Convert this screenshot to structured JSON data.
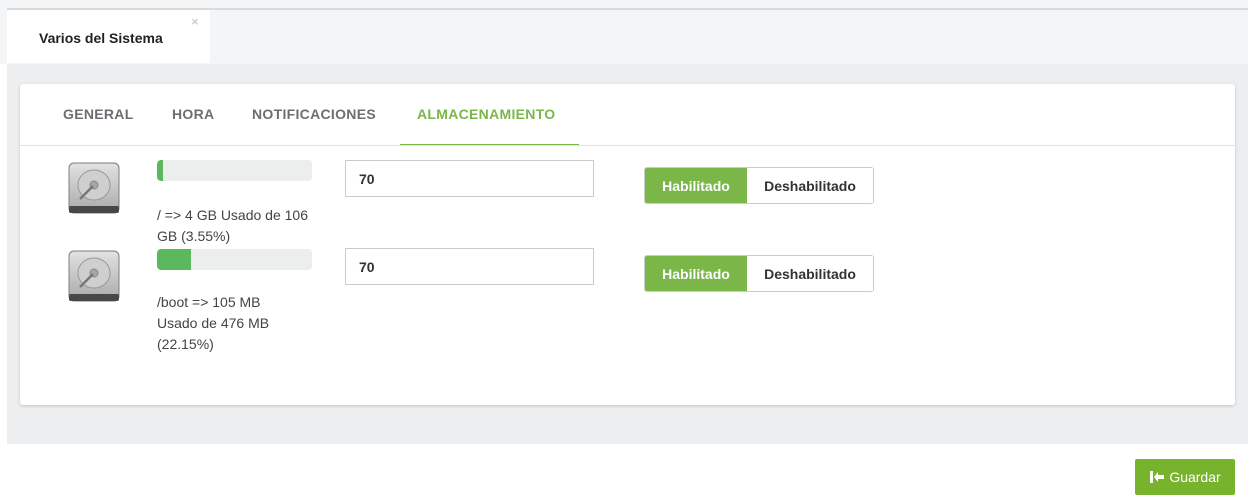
{
  "window_tab": {
    "title": "Varios del Sistema",
    "close_symbol": "×"
  },
  "nav": {
    "tabs": [
      {
        "label": "GENERAL",
        "active": false
      },
      {
        "label": "HORA",
        "active": false
      },
      {
        "label": "NOTIFICACIONES",
        "active": false
      },
      {
        "label": "ALMACENAMIENTO",
        "active": true
      }
    ]
  },
  "disks": [
    {
      "icon": "hard-drive-icon",
      "usage_percent": 3.55,
      "usage_text": "/ => 4 GB Usado de 106 GB (3.55%)",
      "threshold_value": "70",
      "enabled_label": "Habilitado",
      "disabled_label": "Deshabilitado",
      "state": "Habilitado"
    },
    {
      "icon": "hard-drive-icon",
      "usage_percent": 22.15,
      "usage_text": "/boot => 105 MB Usado de 476 MB (22.15%)",
      "threshold_value": "70",
      "enabled_label": "Habilitado",
      "disabled_label": "Deshabilitado",
      "state": "Habilitado"
    }
  ],
  "footer": {
    "save_label": "Guardar",
    "save_icon": "share-arrow-icon"
  },
  "colors": {
    "accent": "#7ab648",
    "progress": "#5cb85c",
    "save_button": "#78b32e"
  }
}
